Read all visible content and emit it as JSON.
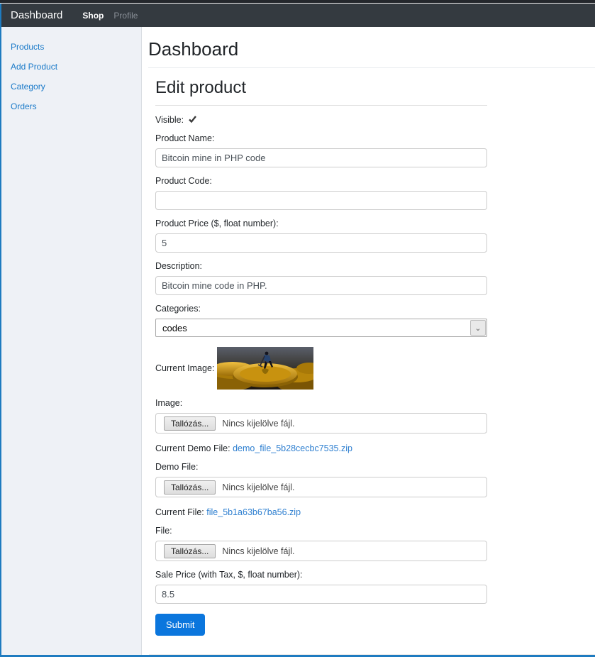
{
  "navbar": {
    "brand": "Dashboard",
    "items": [
      {
        "label": "Shop",
        "active": true
      },
      {
        "label": "Profile",
        "active": false
      }
    ]
  },
  "sidebar": {
    "items": [
      {
        "label": "Products"
      },
      {
        "label": "Add Product"
      },
      {
        "label": "Category"
      },
      {
        "label": "Orders"
      }
    ]
  },
  "main": {
    "page_title": "Dashboard",
    "section_title": "Edit product",
    "form": {
      "visible": {
        "label": "Visible:",
        "checked": true
      },
      "product_name": {
        "label": "Product Name:",
        "value": "Bitcoin mine in PHP code"
      },
      "product_code": {
        "label": "Product Code:",
        "value": ""
      },
      "product_price": {
        "label": "Product Price ($, float number):",
        "value": "5"
      },
      "description": {
        "label": "Description:",
        "value": "Bitcoin mine code in PHP."
      },
      "categories": {
        "label": "Categories:",
        "selected_option": "codes"
      },
      "current_image": {
        "label": "Current Image:"
      },
      "image": {
        "label": "Image:",
        "browse_label": "Tallózás...",
        "no_file_text": "Nincs kijelölve fájl."
      },
      "current_demo_file": {
        "label": "Current Demo File:",
        "link_text": "demo_file_5b28cecbc7535.zip"
      },
      "demo_file": {
        "label": "Demo File:",
        "browse_label": "Tallózás...",
        "no_file_text": "Nincs kijelölve fájl."
      },
      "current_file": {
        "label": "Current File:",
        "link_text": "file_5b1a63b67ba56.zip"
      },
      "file": {
        "label": "File:",
        "browse_label": "Tallózás...",
        "no_file_text": "Nincs kijelölve fájl."
      },
      "sale_price": {
        "label": "Sale Price (with Tax, $, float number):",
        "value": "8.5"
      },
      "submit_label": "Submit"
    }
  },
  "colors": {
    "accent_border": "#1e7bc0",
    "navbar_bg": "#343a40",
    "top_strip_bg": "#24272c",
    "sidebar_bg": "#eef1f6",
    "link_blue": "#2e7fd0",
    "sidebar_link_blue": "#1a7ac9",
    "primary_button": "#0b76dd"
  }
}
